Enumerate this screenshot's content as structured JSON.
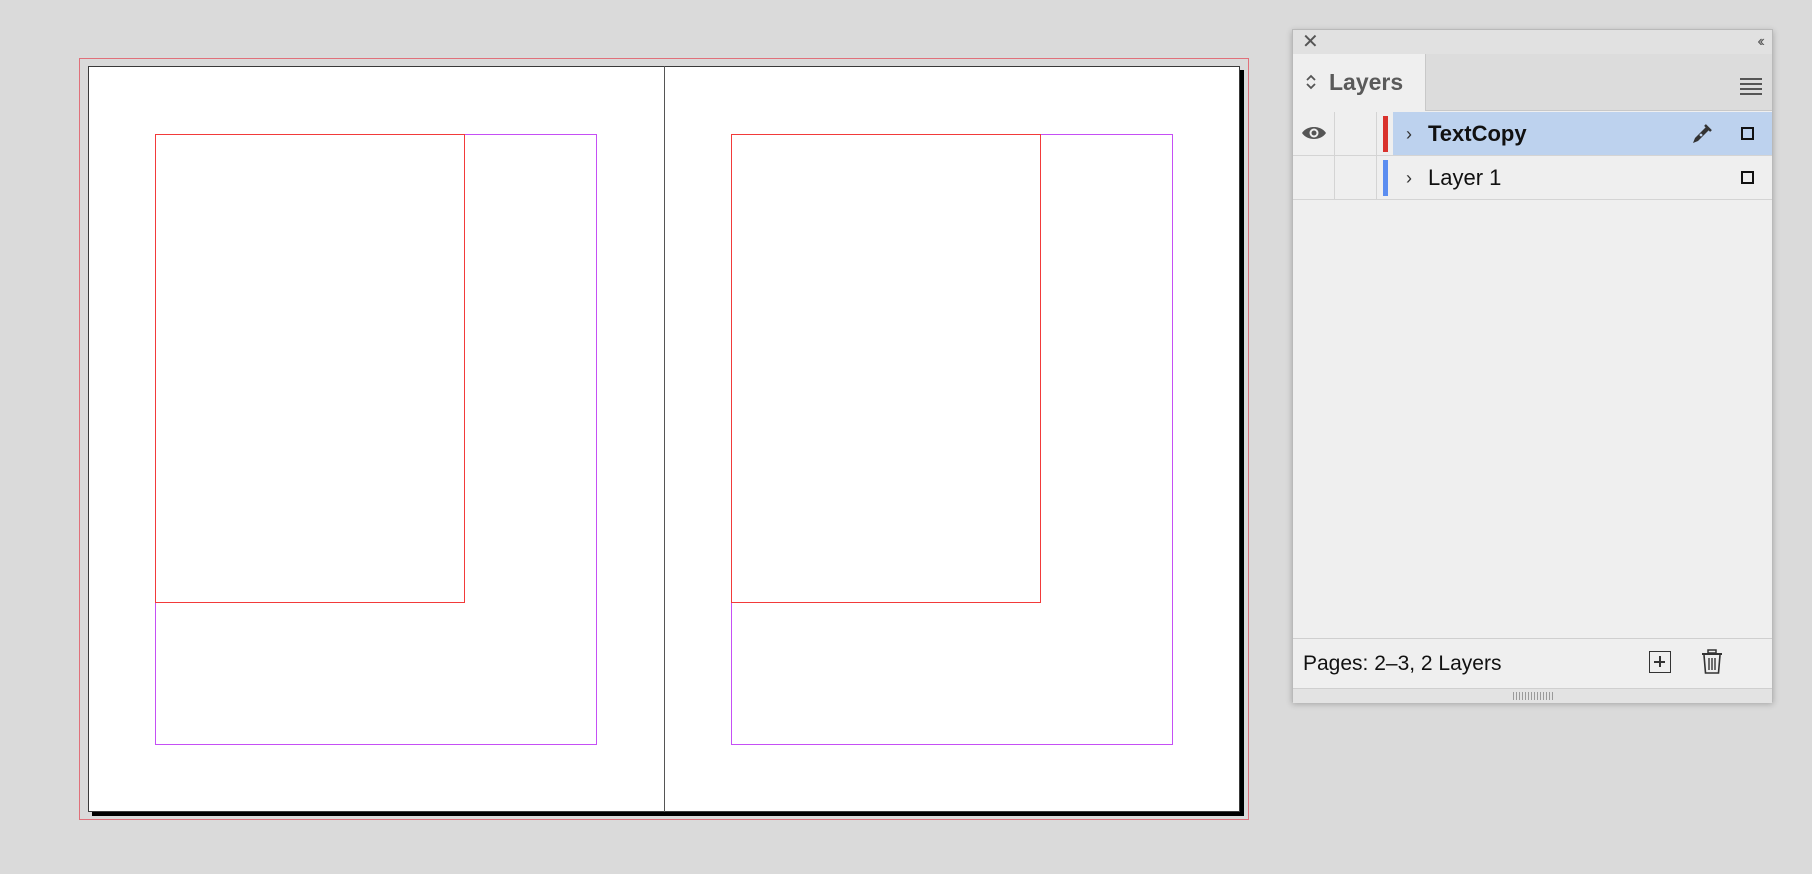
{
  "layers_panel": {
    "tab_label": "Layers",
    "icons": {
      "close": "close-icon",
      "collapse": "collapse-icon",
      "tab_arrows": "updown-arrows-icon",
      "menu": "panel-menu-icon"
    },
    "layers": [
      {
        "name": "TextCopy",
        "selected": true,
        "visible": true,
        "color": "#d9322d",
        "has_pen": true
      },
      {
        "name": "Layer 1",
        "selected": false,
        "visible": false,
        "color": "#5b8df0",
        "has_pen": false
      }
    ],
    "status": "Pages: 2–3, 2 Layers",
    "footer_icons": [
      "new-layer-icon",
      "trash-icon"
    ]
  },
  "document": {
    "pages": 2,
    "colors": {
      "bleed": "#e0707a",
      "margin": "#c54ff5",
      "frame": "#f23a3a"
    }
  }
}
